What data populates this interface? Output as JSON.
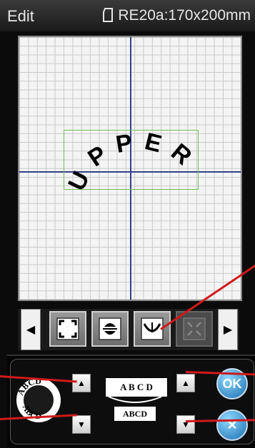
{
  "title_bar": {
    "mode": "Edit",
    "hoop_info": "RE20a:170x200mm",
    "hoop_icon": "hoop-icon"
  },
  "canvas": {
    "text": "UPPER",
    "style": "arc-upward"
  },
  "toolbar": {
    "left_arrow": "◀",
    "right_arrow": "▶",
    "buttons": [
      {
        "icon": "fit-frame-icon"
      },
      {
        "icon": "align-icon"
      },
      {
        "icon": "arc-text-icon"
      },
      {
        "icon": "arc-edit-icon",
        "disabled": true
      }
    ]
  },
  "panel": {
    "preview_top": "ABCD",
    "preview_bottom": "ABCD",
    "flat_label": "A B C D",
    "arc_label": "ABCD",
    "up_glyph": "▲",
    "down_glyph": "▼",
    "ok_label": "OK",
    "cancel_label": "✕"
  },
  "colors": {
    "accent_red": "#d01a1a",
    "axis": "#30408a",
    "selection": "#6fbf5a",
    "ok_blue": "#1a6fb0"
  }
}
